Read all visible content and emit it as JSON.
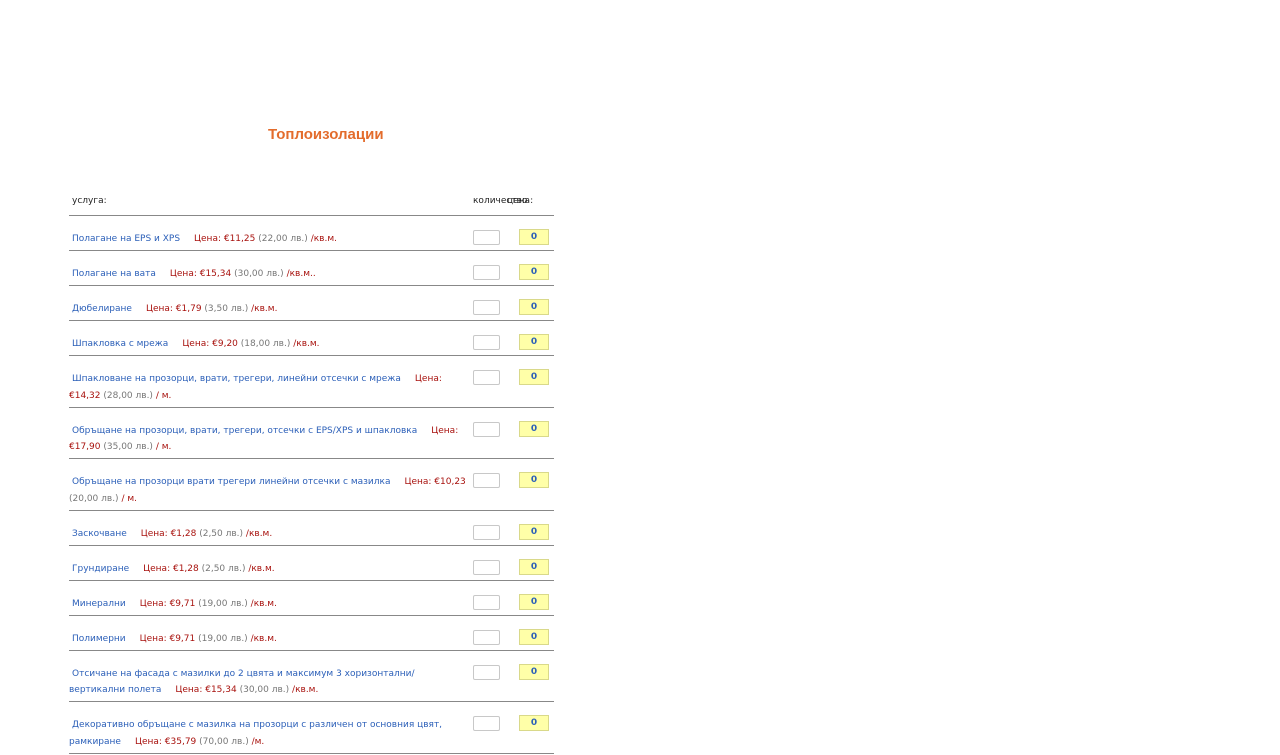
{
  "page_title": "Топлоизолации",
  "table": {
    "headers": {
      "service": "услуга:",
      "quantity": "количество",
      "price": "цена:"
    },
    "price_label": "Цена: ",
    "rows": [
      {
        "service": "Полагане на EPS и XPS",
        "eur": "€11,25",
        "bgn": "(22,00 лв.)",
        "unit": "/кв.м.",
        "total": "0"
      },
      {
        "service": "Полагане на вата",
        "eur": "€15,34",
        "bgn": "(30,00 лв.)",
        "unit": "/кв.м..",
        "total": "0"
      },
      {
        "service": "Дюбелиране",
        "eur": "€1,79",
        "bgn": "(3,50 лв.)",
        "unit": "/кв.м.",
        "total": "0"
      },
      {
        "service": "Шпакловка с мрежа",
        "eur": "€9,20",
        "bgn": "(18,00 лв.)",
        "unit": "/кв.м.",
        "total": "0"
      },
      {
        "service": "Шпакловане на прозорци, врати, трегери, линейни отсечки с мрежа",
        "eur": "€14,32",
        "bgn": "(28,00 лв.)",
        "unit": "/ м.",
        "total": "0"
      },
      {
        "service": "Обръщане на прозорци, врати, трегери, отсечки с EPS/XPS и шпакловка",
        "eur": "€17,90",
        "bgn": "(35,00 лв.)",
        "unit": "/ м.",
        "total": "0"
      },
      {
        "service": "Обръщане на прозорци врати трегери линейни отсечки с мазилка",
        "eur": "€10,23",
        "bgn": "(20,00 лв.)",
        "unit": "/ м.",
        "total": "0"
      },
      {
        "service": "Заскочване",
        "eur": "€1,28",
        "bgn": "(2,50 лв.)",
        "unit": "/кв.м.",
        "total": "0"
      },
      {
        "service": "Грундиране",
        "eur": "€1,28",
        "bgn": "(2,50 лв.)",
        "unit": "/кв.м.",
        "total": "0"
      },
      {
        "service": "Минерални",
        "eur": "€9,71",
        "bgn": "(19,00 лв.)",
        "unit": "/кв.м.",
        "total": "0"
      },
      {
        "service": "Полимерни",
        "eur": "€9,71",
        "bgn": "(19,00 лв.)",
        "unit": "/кв.м.",
        "total": "0"
      },
      {
        "service": "Отсичане на фасада с мазилки до 2 цвята и максимум 3 хоризонтални/вертикални полета",
        "eur": "€15,34",
        "bgn": "(30,00 лв.)",
        "unit": "/кв.м.",
        "total": "0"
      },
      {
        "service": "Декоративно обръщане с мазилка на прозорци с различен от основния цвят, рамкиране",
        "eur": "€35,79",
        "bgn": "(70,00 лв.)",
        "unit": "/м.",
        "total": "0"
      }
    ]
  }
}
